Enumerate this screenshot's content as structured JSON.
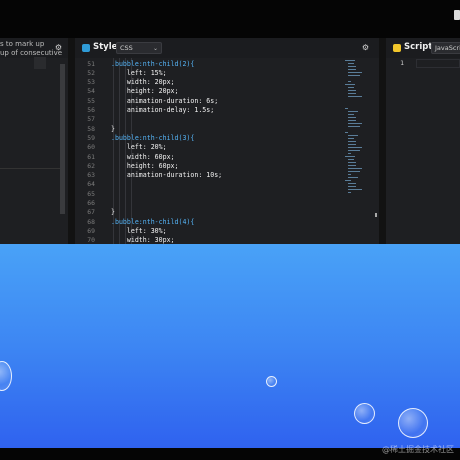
{
  "html_panel": {
    "hint_lines": [
      "s to mark up",
      "up of consecutive"
    ]
  },
  "style_panel": {
    "title": "Style",
    "language": "CSS",
    "line_numbers": [
      "51",
      "52",
      "53",
      "54",
      "55",
      "56",
      "57",
      "58",
      "59",
      "60",
      "61",
      "62",
      "63",
      "64",
      "65",
      "66",
      "67",
      "68",
      "69",
      "70"
    ],
    "code_lines": [
      ".bubble:nth-child(2){",
      "    left: 15%;",
      "    width: 20px;",
      "    height: 20px;",
      "    animation-duration: 6s;",
      "    animation-delay: 1.5s;",
      "",
      "}",
      ".bubble:nth-child(3){",
      "    left: 20%;",
      "    width: 60px;",
      "    height: 60px;",
      "    animation-duration: 10s;",
      "",
      "",
      "",
      "}",
      ".bubble:nth-child(4){",
      "    left: 30%;",
      "    width: 30px;"
    ],
    "code_kinds": [
      "sel",
      "prop",
      "prop",
      "prop",
      "prop",
      "prop",
      "prop",
      "brace",
      "sel",
      "prop",
      "prop",
      "prop",
      "prop",
      "prop",
      "prop",
      "prop",
      "brace",
      "sel",
      "prop",
      "prop"
    ]
  },
  "script_panel": {
    "title": "Script",
    "language": "JavaScript",
    "line_numbers": [
      "1"
    ]
  },
  "preview": {
    "background_top": "#49a2f7",
    "background_bottom": "#2f62ef"
  },
  "watermark": "@稀土掘金技术社区",
  "colors": {
    "selector": "#55b3f5",
    "css_badge": "#2f9bd7",
    "js_badge": "#f2c62b"
  },
  "icons": {
    "settings": "gear-icon",
    "css_badge": "css-badge-icon",
    "js_badge": "js-badge-icon",
    "dropdown": "chevron-down-icon"
  }
}
